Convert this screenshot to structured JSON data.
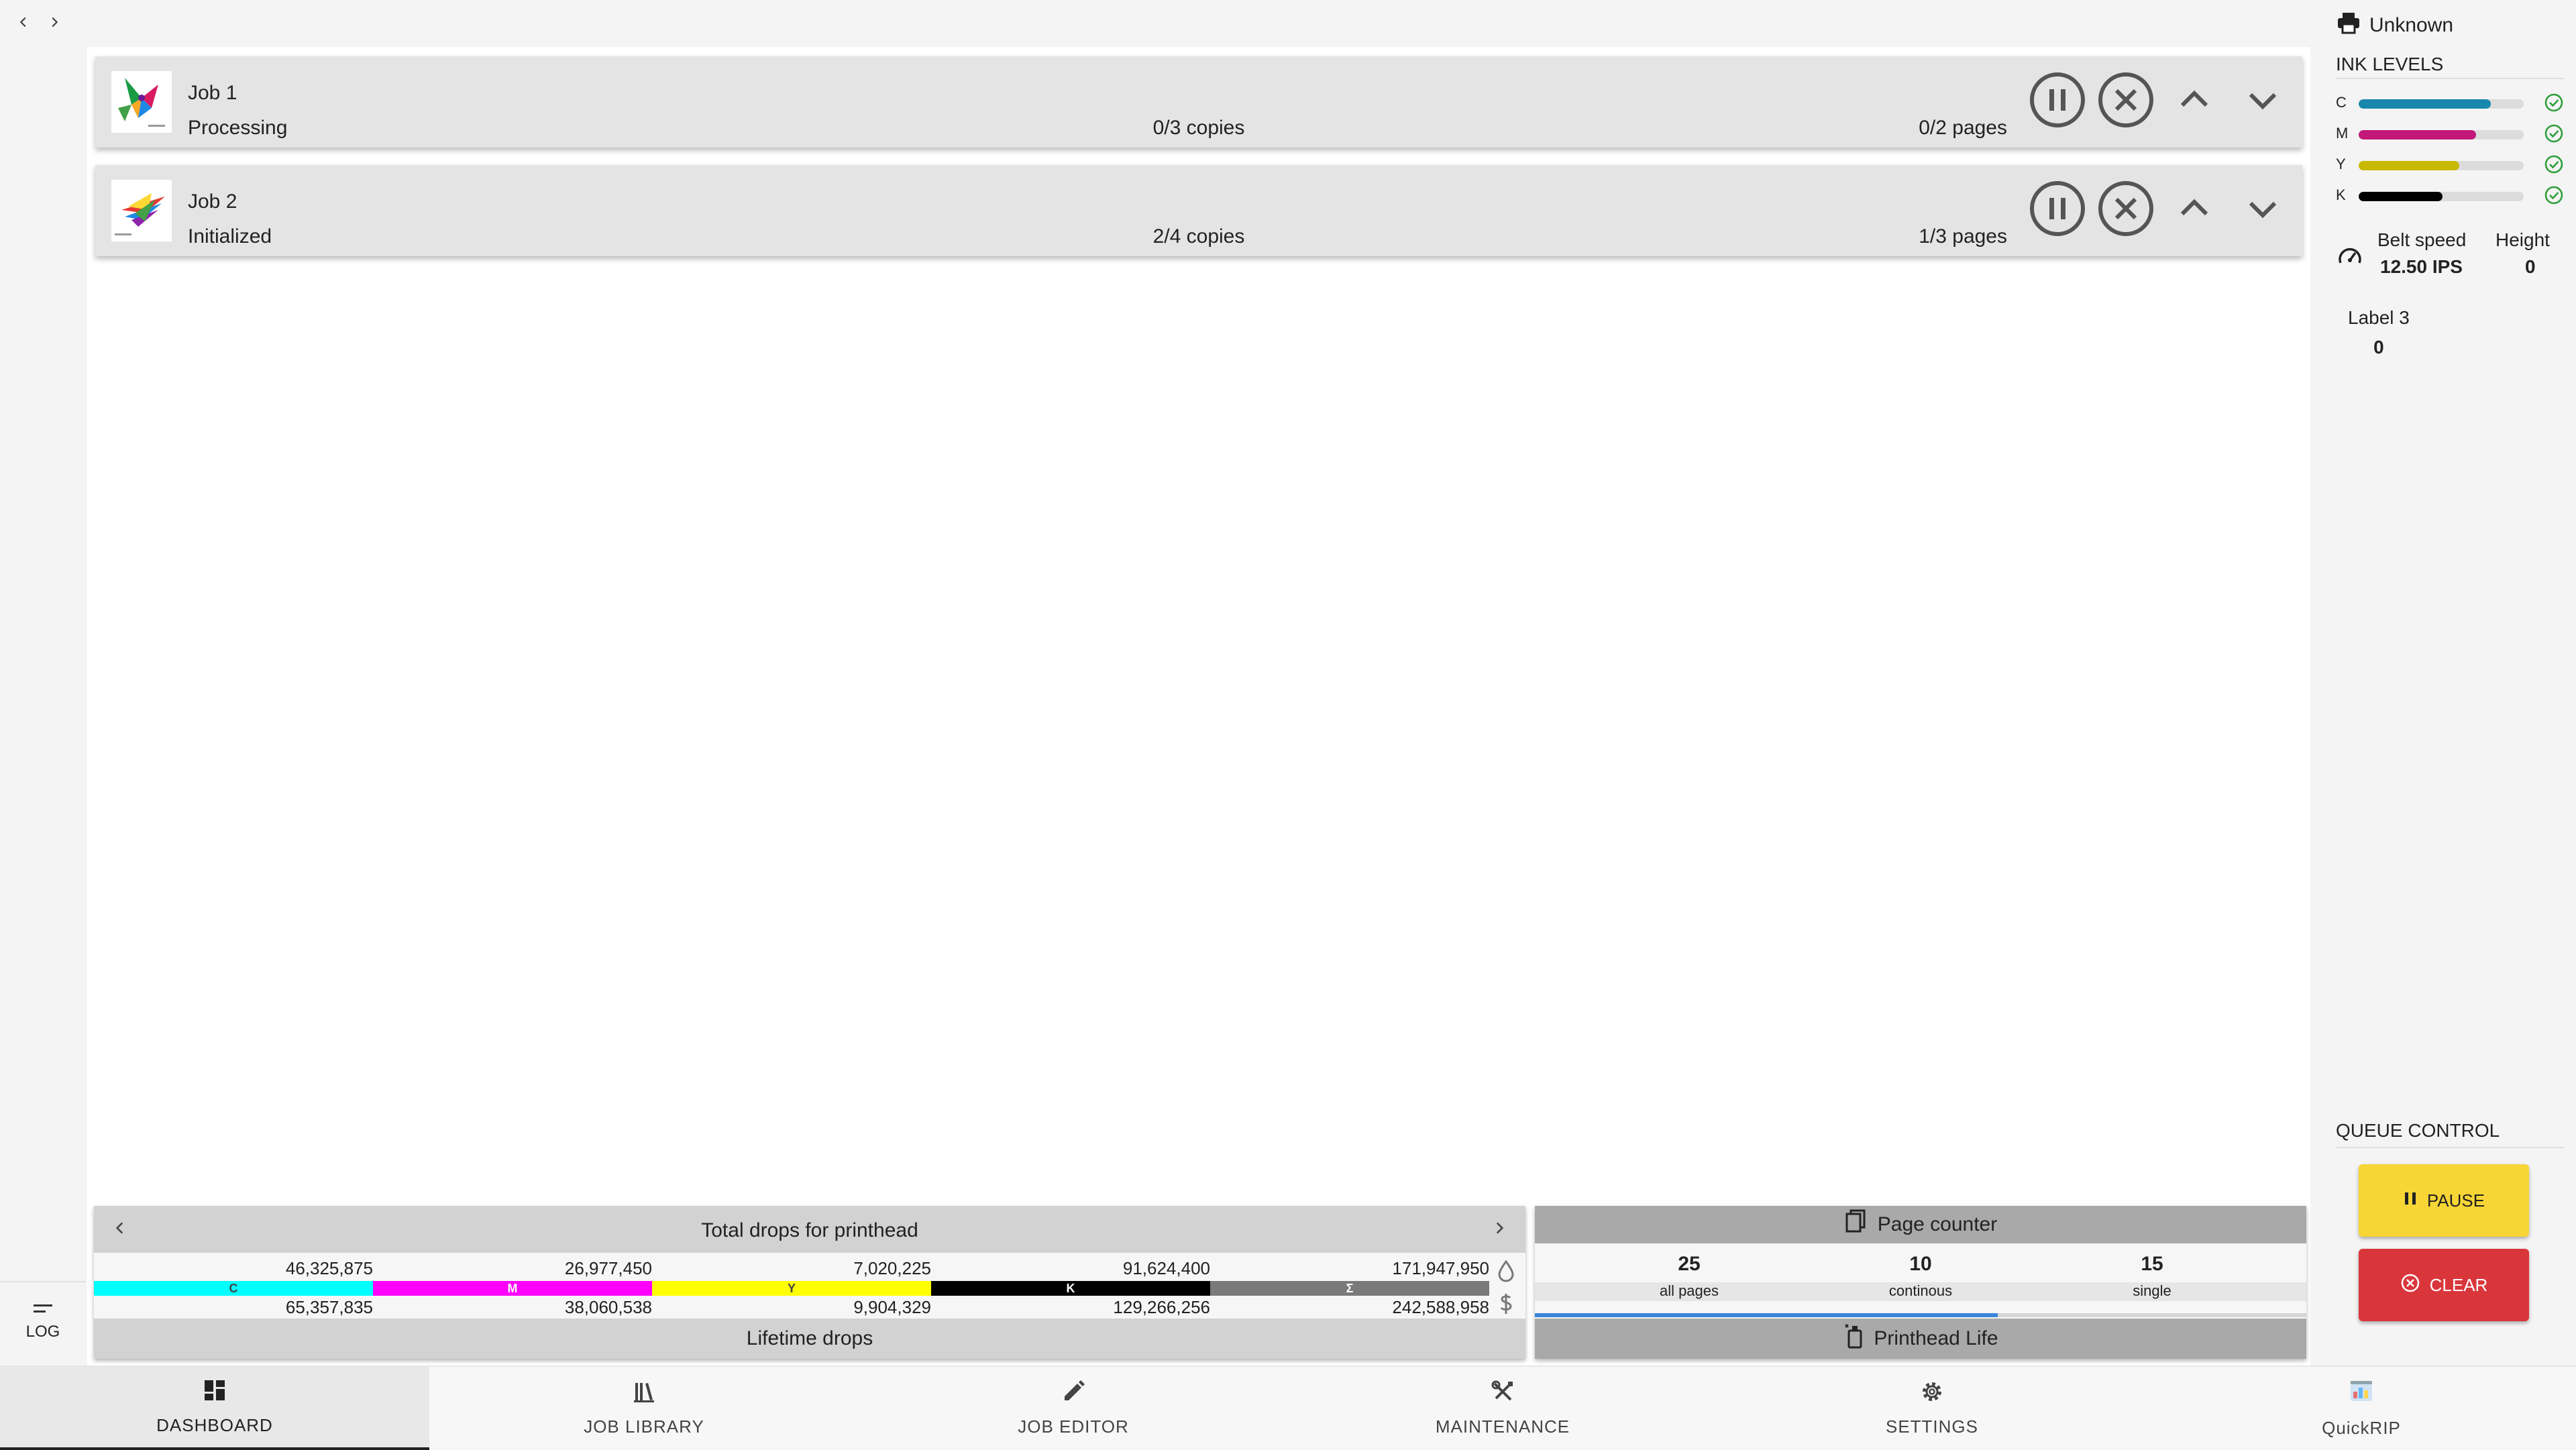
{
  "history": {
    "back_icon": "chevron-left-icon",
    "forward_icon": "chevron-right-icon"
  },
  "log": {
    "label": "LOG",
    "icon": "short-text-icon"
  },
  "jobs": [
    {
      "name": "Job 1",
      "status": "Processing",
      "copies": "0/3 copies",
      "pages": "0/2 pages"
    },
    {
      "name": "Job 2",
      "status": "Initialized",
      "copies": "2/4 copies",
      "pages": "1/3 pages"
    }
  ],
  "drops": {
    "title": "Total drops for printhead",
    "footer": "Lifetime drops",
    "channels": [
      {
        "key": "C",
        "color": "#00ffff",
        "label_color": "#444444",
        "total": "46,325,875",
        "lifetime": "65,357,835"
      },
      {
        "key": "M",
        "color": "#ff00ff",
        "label_color": "#ffffff",
        "total": "26,977,450",
        "lifetime": "38,060,538"
      },
      {
        "key": "Y",
        "color": "#ffff00",
        "label_color": "#444444",
        "total": "7,020,225",
        "lifetime": "9,904,329"
      },
      {
        "key": "K",
        "color": "#000000",
        "label_color": "#ffffff",
        "total": "91,624,400",
        "lifetime": "129,266,256"
      },
      {
        "key": "Σ",
        "color": "#7a7a7a",
        "label_color": "#ffffff",
        "total": "171,947,950",
        "lifetime": "242,588,958"
      }
    ]
  },
  "page_counter": {
    "title": "Page counter",
    "stats": [
      {
        "value": "25",
        "label": "all pages"
      },
      {
        "value": "10",
        "label": "continous"
      },
      {
        "value": "15",
        "label": "single"
      }
    ],
    "progress": 0.6,
    "footer": "Printhead Life"
  },
  "sidebar": {
    "printer_status": "Unknown",
    "ink_title": "INK LEVELS",
    "inks": [
      {
        "key": "C",
        "level": 0.8,
        "color": "#1a87ad"
      },
      {
        "key": "M",
        "level": 0.71,
        "color": "#c2187a"
      },
      {
        "key": "Y",
        "level": 0.61,
        "color": "#c6b900"
      },
      {
        "key": "K",
        "level": 0.51,
        "color": "#000000"
      }
    ],
    "belt_speed_label": "Belt speed",
    "belt_speed_value": "12.50 IPS",
    "height_label": "Height",
    "height_value": "0",
    "label3_label": "Label 3",
    "label3_value": "0",
    "queue_title": "QUEUE CONTROL",
    "pause_label": "PAUSE",
    "clear_label": "CLEAR",
    "pause_color": "#f7d535",
    "clear_color": "#d9363c"
  },
  "nav": {
    "tabs": [
      {
        "label": "DASHBOARD",
        "icon": "dashboard-icon"
      },
      {
        "label": "JOB LIBRARY",
        "icon": "library-icon"
      },
      {
        "label": "JOB EDITOR",
        "icon": "pencil-icon"
      },
      {
        "label": "MAINTENANCE",
        "icon": "tools-icon"
      },
      {
        "label": "SETTINGS",
        "icon": "gear-icon"
      },
      {
        "label": "QuickRIP",
        "icon": "quickrip-icon"
      }
    ]
  }
}
